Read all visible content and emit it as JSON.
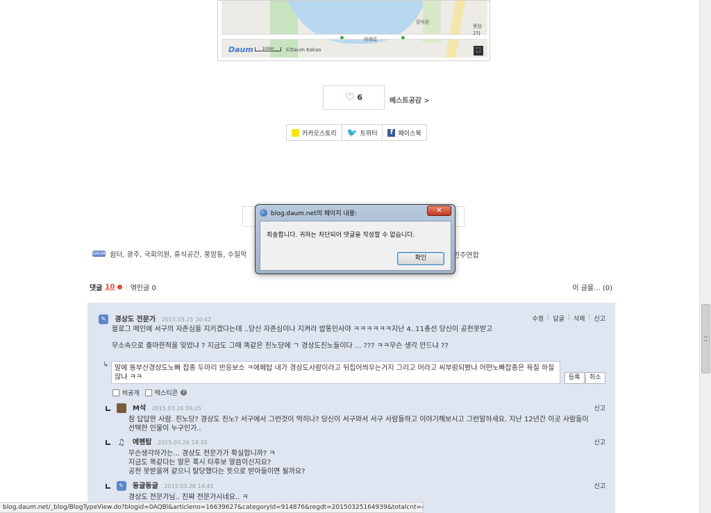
{
  "map": {
    "labels": [
      "장미원",
      "위례로",
      "풍암\n2차"
    ],
    "logo": "Daum",
    "scale": "100m",
    "copyright": "©Daum Kakao"
  },
  "like": {
    "count": "6",
    "best_link": "베스트공감 >"
  },
  "share": {
    "kakao": "카카오스토리",
    "twitter": "트위터",
    "facebook": "페이스북"
  },
  "tags": {
    "icon_label": "DAUM",
    "text": "쉼터, 광주, 국회의원, 휴식공간, 풍암동, 수질악",
    "end_text": "민주연합"
  },
  "comments_header": {
    "label": "댓글",
    "count": "10",
    "trackback": "엮인글 0",
    "right_link": "이 글을... (0)"
  },
  "main_comment": {
    "author": "경상도 전문가",
    "date": "2015.03.25 20:42",
    "actions": [
      "수정",
      "답글",
      "삭제",
      "신고"
    ],
    "body_1": "블로그 메인에 서구의 자존심을 지키겠다는데 ..당신 자존심이나 지켜라 밥통인사야 ㅋㅋㅋㅋㅋㅋ지난 4..11총선   당신이 공천못받고",
    "body_2": "무소속으로 출마한적을 잊었냐 ? 지금도 그때 똑같은 친노당에 ㄱ 경상도친노들이다 ... ??? ㅋㅋ무슨 생각 안드냐 ??"
  },
  "reply_form": {
    "text": "말에 똥부산경상도노빠 잡종 두마리 반응보소  ㅋ에페탑 내가 경상도사람이라고 뒤집어씌우는거지  그리고 머라고 씨부렁되봤냐 어떤노빠잡종은 욕질 하질않냐 ㅋㅋ",
    "submit": "등록",
    "cancel": "취소",
    "private": "비공개",
    "emoticon": "텍스티콘"
  },
  "replies": [
    {
      "author": "M석",
      "date": "2015.03.26 09:25",
      "report": "신고",
      "lines": [
        "참 답답한 사람. 친노당? 경상도 친노? 서구에서 그런것이 먹히나? 당신이 서구와서 서구 사람들하고 이야기해보시고 그런말하세요. 지난 12년간 이곳 사람들이",
        "선택한 인물이 누구인가.."
      ]
    },
    {
      "author": "에펜탑",
      "date": "2015.03.26 14:33",
      "report": "신고",
      "lines": [
        "무슨생각하가는... 경상도 전문가가 확실합니까? ㅋ",
        "지금도 똑같다는 말은 혹시 타후보 말씀이신지요?",
        "공천 못받을꺼 같으니 탈당했다는 뜻으로 받아들이면 될까요?"
      ]
    },
    {
      "author": "둥글둥글",
      "date": "2015.03.26 14:41",
      "report": "신고",
      "lines": [
        "경상도 전문가님.. 진짜 전문가시네요.. ㅋ"
      ]
    }
  ],
  "status_bar": "blog.daum.net/_blog/BlogTypeView.do?blogid=0AQBl&articleno=16639627&categoryId=914876&regdt=20150325164939&totalcnt=42#",
  "dialog": {
    "title": "blog.daum.net의 페이지 내용:",
    "message": "죄송합니다. 귀하는 차단되어 댓글을 작성할 수 없습니다.",
    "ok": "확인",
    "close": "✕"
  }
}
